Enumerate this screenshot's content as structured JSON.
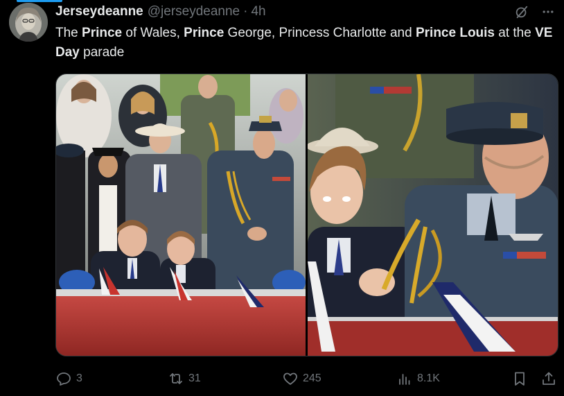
{
  "tweet": {
    "author_name": "Jerseydeanne",
    "author_handle": "@jerseydeanne",
    "separator": "·",
    "timestamp": "4h",
    "text_parts": [
      {
        "t": "The ",
        "bold": false
      },
      {
        "t": "Prince",
        "bold": true
      },
      {
        "t": " of Wales, ",
        "bold": false
      },
      {
        "t": "Prince",
        "bold": true
      },
      {
        "t": " George, Princess Charlotte and ",
        "bold": false
      },
      {
        "t": "Prince Louis",
        "bold": true
      },
      {
        "t": " at the ",
        "bold": false
      },
      {
        "t": "VE Day",
        "bold": true
      },
      {
        "t": " parade",
        "bold": false
      }
    ]
  },
  "media": {
    "left_photo_icon": "photo-parade-family",
    "right_photo_icon": "photo-parade-closeup"
  },
  "actions": {
    "replies": "3",
    "reposts": "31",
    "likes": "245",
    "views": "8.1K"
  },
  "colors": {
    "background": "#000000",
    "text": "#e7e9ea",
    "secondary": "#71767b",
    "accent": "#1d9bf0"
  },
  "icons": {
    "grok": "grok-icon",
    "more": "more-icon",
    "reply": "reply-icon",
    "repost": "repost-icon",
    "like": "heart-icon",
    "views": "views-icon",
    "bookmark": "bookmark-icon",
    "share": "share-icon"
  }
}
